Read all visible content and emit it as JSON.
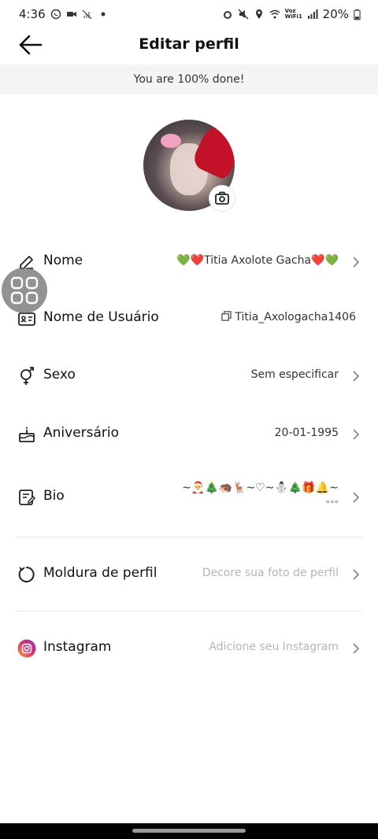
{
  "status_bar": {
    "time": "4:36",
    "battery": "20%",
    "network_label": "Voz WiFi1"
  },
  "header": {
    "title": "Editar perfil"
  },
  "banner": {
    "text": "You are 100% done!"
  },
  "rows": {
    "nome": {
      "label": "Nome",
      "value": "💚❤️Titia Axolote Gacha❤️💚"
    },
    "usuario": {
      "label": "Nome de Usuário",
      "value": "Titia_Axologacha1406"
    },
    "sexo": {
      "label": "Sexo",
      "value": "Sem especificar"
    },
    "aniversario": {
      "label": "Aniversário",
      "value": "20-01-1995"
    },
    "bio": {
      "label": "Bio",
      "value": "~🎅🎄🦔🦌~♡~⛄🎄🎁🔔~",
      "value_more": "°°°"
    },
    "moldura": {
      "label": "Moldura de perfil",
      "value": "Decore sua foto de perfil"
    },
    "instagram": {
      "label": "Instagram",
      "value": "Adicione seu Instagram"
    }
  },
  "colors": {
    "banner_bg": "#f4f4f4",
    "muted_text": "#b5b5b5",
    "instagram_gradient": [
      "#f9a13a",
      "#e1306c",
      "#833ab4"
    ]
  }
}
